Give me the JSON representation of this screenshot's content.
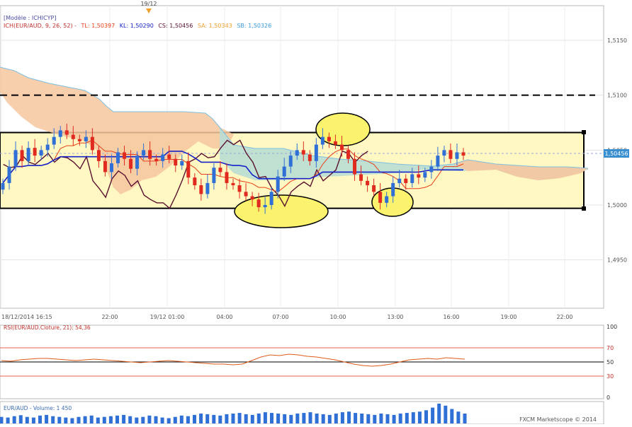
{
  "header": {
    "model_label": "[Modèle : ICHICYP]",
    "ichimoku_name": "ICH(EUR/AUD, 9, 26, 52) -",
    "tl_label": "TL: 1,50397",
    "kl_label": "KL: 1,50290",
    "cs_label": "CS: 1,50456",
    "sa_label": "SA: 1,50343",
    "sb_label": "SB: 1,50326",
    "date_marker": "19/12"
  },
  "colors": {
    "bull_candle": "#2f6fd6",
    "bear_candle": "#e02a20",
    "tenkan": "#e8401a",
    "kijun": "#1522c8",
    "chikou": "#5a1030",
    "kumo_bear_fill": "#f6c79f",
    "kumo_bull_fill": "#b9ddd4",
    "senkou_b": "#7fbfe0",
    "channel_fill": "#fff8c2",
    "highlight_fill": "#fbf36e",
    "rsi_line": "#e05a1a",
    "volume_bar": "#2f6fd6",
    "price_tag": "#3a8fd0"
  },
  "price_axis": {
    "ticks": [
      "1,5150",
      "1,5100",
      "1,5050",
      "1,5000",
      "1,4950"
    ],
    "current_price": "1,50456",
    "resistance_level": 1.51,
    "channel_top": 1.5066,
    "channel_bottom": 1.4997
  },
  "time_axis": {
    "labels": [
      "18/12/2014 16:15",
      "22:00",
      "19/12 01:00",
      "04:00",
      "07:00",
      "10:00",
      "13:00",
      "16:00",
      "19:00",
      "22:00"
    ]
  },
  "rsi_panel": {
    "label": "RSI(EUR/AUD.Cloture, 21): 54,36",
    "axis_ticks": [
      "100",
      "70",
      "50",
      "30",
      "0"
    ]
  },
  "volume_panel": {
    "label": "EUR/AUD - Volume: 1 450"
  },
  "footer": {
    "credit": "FXCM Marketscope © 2014"
  },
  "chart_data": {
    "type": "candlestick",
    "title": "ICH(EUR/AUD, 9, 26, 52)",
    "y_range": [
      1.4915,
      1.518
    ],
    "price_candles_close": [
      1.502,
      1.5035,
      1.505,
      1.504,
      1.5052,
      1.5045,
      1.505,
      1.5055,
      1.5062,
      1.5068,
      1.5064,
      1.506,
      1.5058,
      1.5062,
      1.505,
      1.504,
      1.503,
      1.5038,
      1.5048,
      1.5042,
      1.5033,
      1.5045,
      1.505,
      1.5042,
      1.504,
      1.5046,
      1.5042,
      1.5036,
      1.504,
      1.5025,
      1.5018,
      1.501,
      1.502,
      1.5034,
      1.503,
      1.502,
      1.5018,
      1.5012,
      1.5008,
      1.5005,
      1.4998,
      1.5,
      1.5012,
      1.5026,
      1.5035,
      1.5045,
      1.505,
      1.5046,
      1.504,
      1.5055,
      1.5062,
      1.5058,
      1.5055,
      1.505,
      1.5042,
      1.5028,
      1.5022,
      1.5018,
      1.5012,
      1.5002,
      1.5008,
      1.502,
      1.5024,
      1.502,
      1.5028,
      1.5025,
      1.503,
      1.5035,
      1.5045,
      1.505,
      1.5042,
      1.5048,
      1.5045
    ],
    "resistance_line": 1.51,
    "rsi": {
      "period": 21,
      "value": 54.36,
      "levels": [
        70,
        50,
        30
      ],
      "values": [
        52,
        51,
        53,
        54,
        55,
        55,
        54,
        53,
        52,
        53,
        54,
        53,
        52,
        51,
        50,
        49,
        50,
        51,
        52,
        51,
        50,
        49,
        48,
        47,
        47,
        46,
        47,
        52,
        57,
        60,
        59,
        61,
        60,
        58,
        57,
        55,
        53,
        50,
        47,
        45,
        44,
        45,
        47,
        50,
        53,
        54,
        55,
        54,
        56,
        55,
        54
      ]
    },
    "volume": {
      "last": 1450,
      "values": [
        20,
        18,
        22,
        25,
        20,
        18,
        24,
        26,
        22,
        20,
        18,
        16,
        20,
        22,
        24,
        18,
        20,
        22,
        24,
        26,
        22,
        18,
        20,
        24,
        22,
        18,
        16,
        20,
        24,
        22,
        26,
        30,
        28,
        26,
        24,
        28,
        30,
        32,
        28,
        26,
        30,
        34,
        32,
        30,
        28,
        26,
        30,
        32,
        34,
        30,
        28,
        26,
        30,
        34,
        36,
        32,
        30,
        28,
        26,
        30,
        28,
        26,
        30,
        32,
        34,
        36,
        40,
        48,
        60,
        54,
        44,
        36,
        30
      ]
    }
  }
}
